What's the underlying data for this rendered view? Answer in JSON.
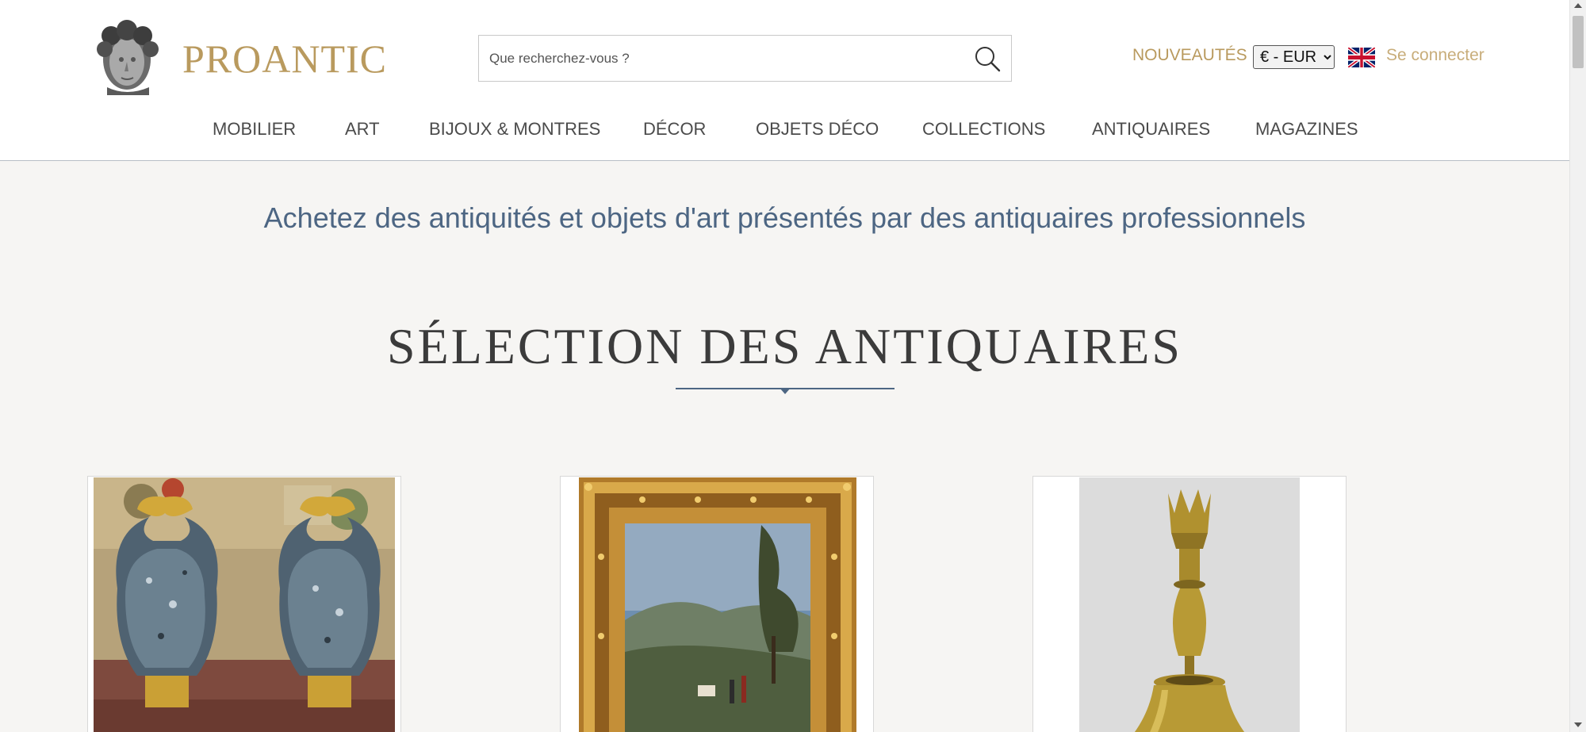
{
  "brand": {
    "name": "PROANTIC",
    "logo_icon": "antique-bust-icon"
  },
  "search": {
    "placeholder": "Que recherchez-vous ?"
  },
  "header_links": {
    "new_label": "NOUVEAUTÉS",
    "currency_selected": "€ - EUR",
    "language_flag": "uk-flag-icon",
    "login_label": "Se connecter"
  },
  "nav": {
    "items": [
      {
        "label": "MOBILIER"
      },
      {
        "label": "ART"
      },
      {
        "label": "BIJOUX & MONTRES"
      },
      {
        "label": "DÉCOR"
      },
      {
        "label": "OBJETS DÉCO"
      },
      {
        "label": "COLLECTIONS"
      },
      {
        "label": "ANTIQUAIRES"
      },
      {
        "label": "MAGAZINES"
      }
    ]
  },
  "main": {
    "tagline": "Achetez des antiquités et objets d'art présentés par des antiquaires professionnels",
    "section_title": "SÉLECTION DES ANTIQUAIRES",
    "cards": [
      {
        "image": "pair-of-marble-vases-image"
      },
      {
        "image": "framed-landscape-painting-image"
      },
      {
        "image": "bronze-candlestick-image"
      }
    ]
  },
  "colors": {
    "gold": "#b99a5e",
    "navy": "#4d6683",
    "background": "#f6f5f3"
  }
}
